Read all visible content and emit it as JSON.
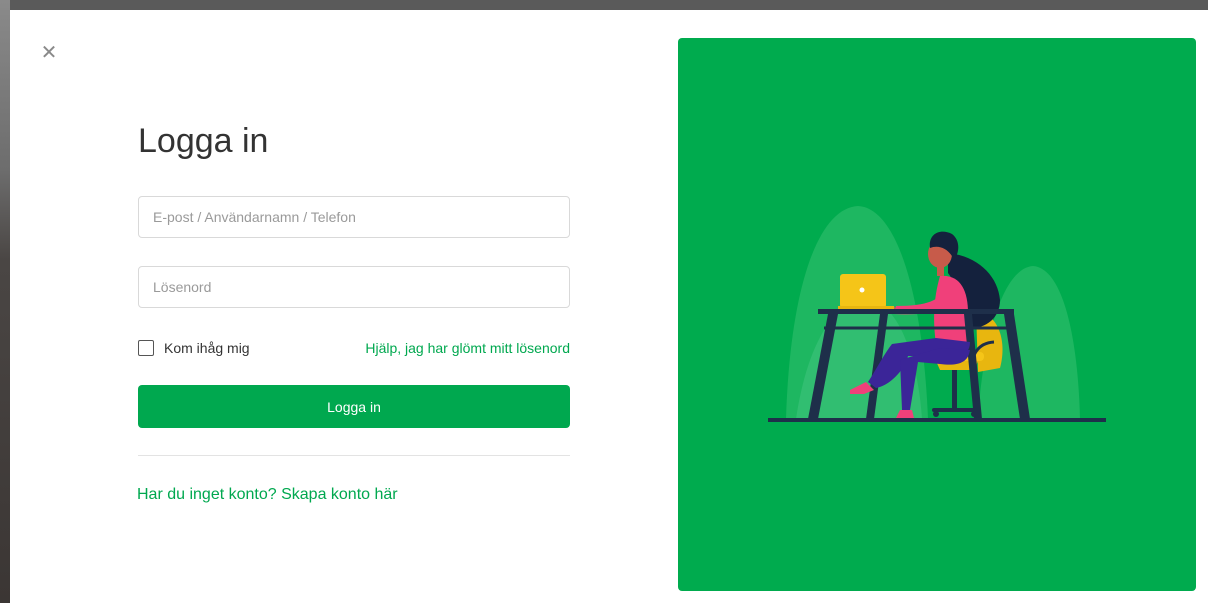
{
  "modal": {
    "close_icon": "close-icon",
    "title": "Logga in",
    "email_field": {
      "placeholder": "E-post / Användarnamn / Telefon",
      "value": ""
    },
    "password_field": {
      "placeholder": "Lösenord",
      "value": ""
    },
    "remember_me": {
      "label": "Kom ihåg mig",
      "checked": false
    },
    "forgot_password_link": "Hjälp, jag har glömt mitt lösenord",
    "login_button": "Logga in",
    "signup_link": "Har du inget konto? Skapa konto här"
  },
  "illustration": {
    "subject": "woman-working-on-laptop-illustration"
  },
  "colors": {
    "accent": "#00a84f",
    "panel_background": "#00ab4e",
    "title_text": "#333333",
    "woman_top": "#f0407a",
    "woman_pants": "#3b2598",
    "laptop": "#f5c518",
    "desk": "#1e2f4a",
    "chair": "#f5c518"
  }
}
